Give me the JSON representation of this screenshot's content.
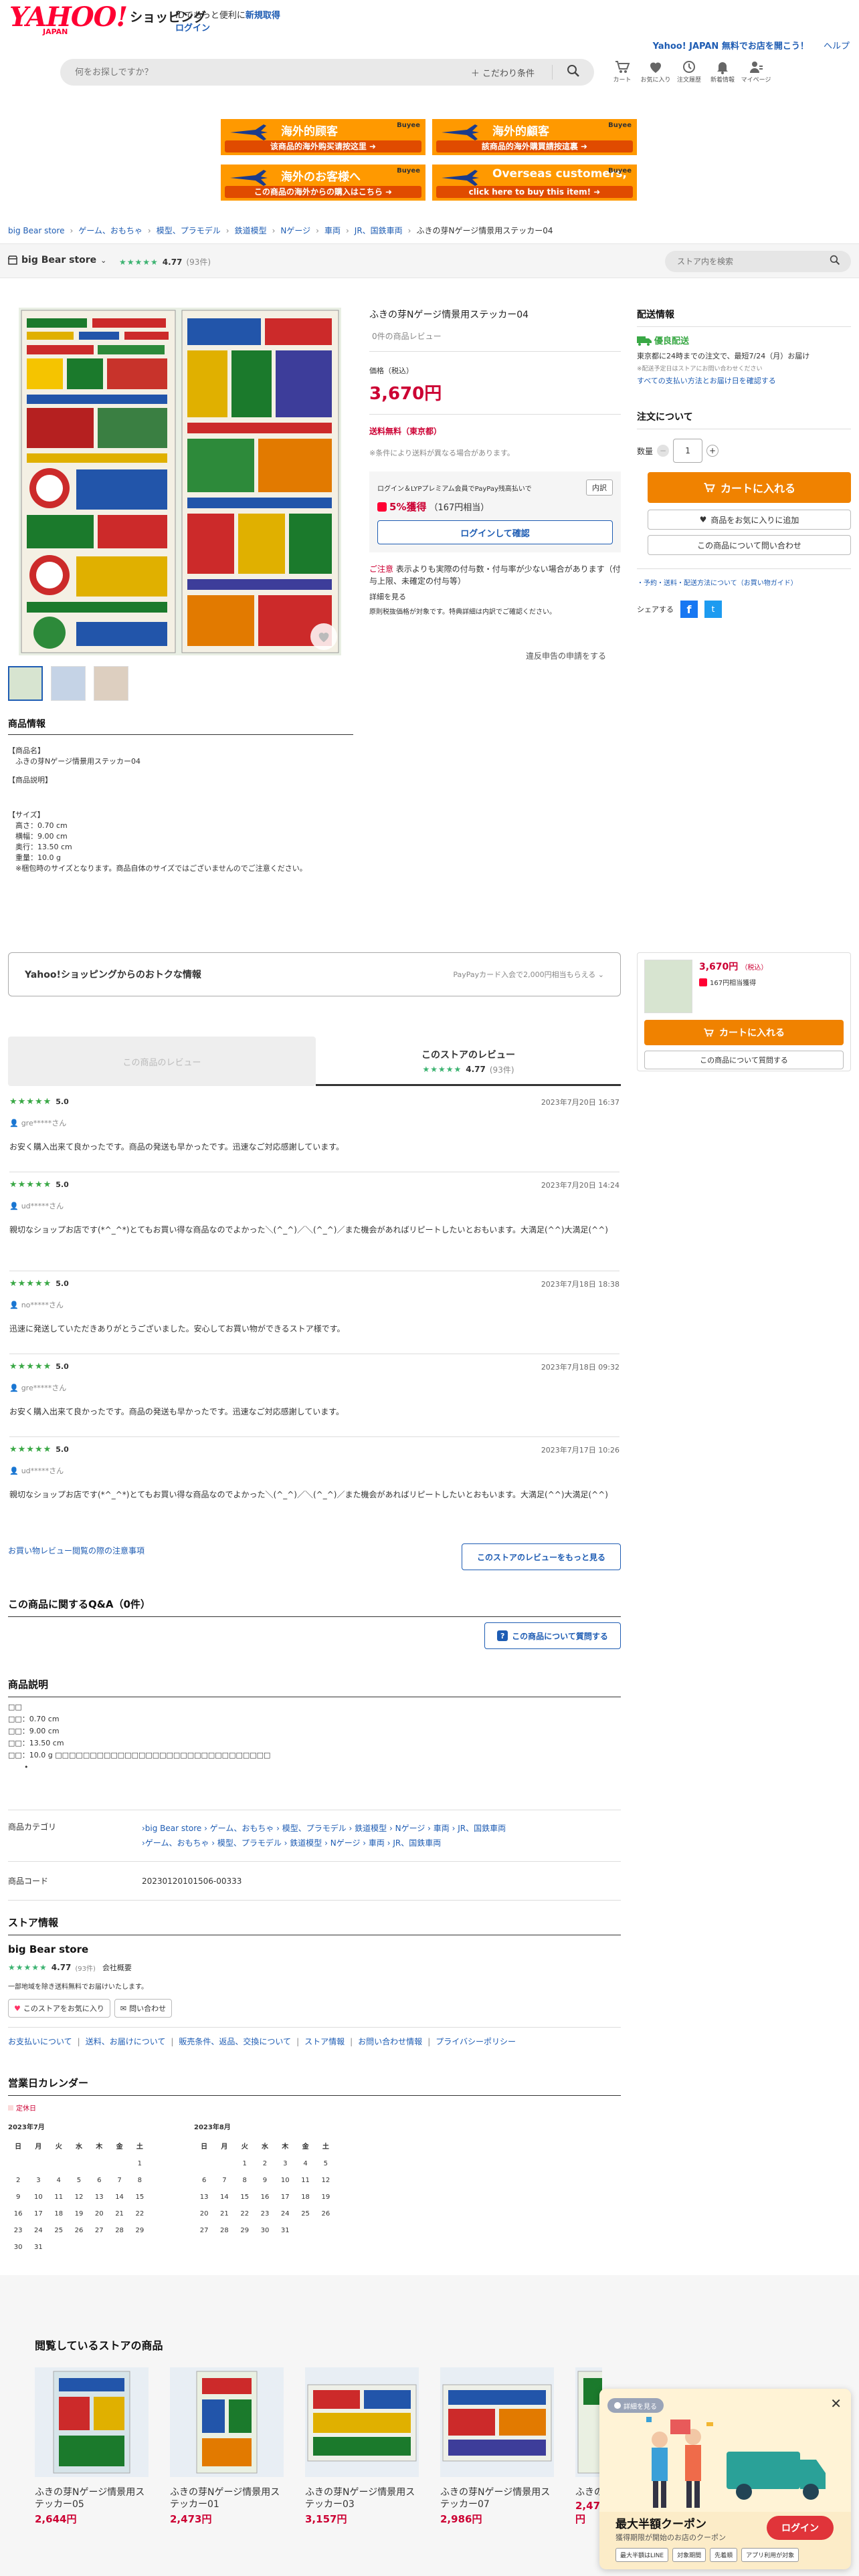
{
  "header": {
    "logo_main": "YAHOO!",
    "logo_sub": "JAPAN",
    "logo_shopping": "ショッピング",
    "id_note_prefix": "IDでもっと便利に",
    "signup": "新規取得",
    "login": "ログイン",
    "top_right_text": "Yahoo! JAPAN  無料でお店を開こう！",
    "help": "ヘルプ",
    "search_placeholder": "何をお探しですか？",
    "filter_label": "＋ こだわり条件",
    "icons": [
      {
        "name": "cart-icon",
        "label": "カート"
      },
      {
        "name": "heart-icon",
        "label": "お気に入り"
      },
      {
        "name": "history-icon",
        "label": "注文履歴"
      },
      {
        "name": "bell-icon",
        "label": "新着情報"
      },
      {
        "name": "user-icon",
        "label": "マイページ"
      }
    ]
  },
  "banners": [
    {
      "t1": "海外的顾客",
      "t2": "该商品的海外购买请按这里 ➜",
      "buyee": "Buyee"
    },
    {
      "t1": "海外的顧客",
      "t2": "該商品的海外購買請按這裏 ➜",
      "buyee": "Buyee"
    },
    {
      "t1": "海外のお客様へ",
      "t2": "この商品の海外からの購入はこちら ➜",
      "buyee": "Buyee"
    },
    {
      "t1": "Overseas customers,",
      "t2": "click here to buy this item! ➜",
      "buyee": "Buyee"
    }
  ],
  "breadcrumb": [
    "big Bear store",
    "ゲーム、おもちゃ",
    "模型、プラモデル",
    "鉄道模型",
    "Nゲージ",
    "車両",
    "JR、国鉄車両",
    "ふきの芽Nゲージ情景用ステッカー04"
  ],
  "store_bar": {
    "store_name": "big Bear store",
    "rating": "4.77",
    "rating_count": "(93件)",
    "search_placeholder": "ストア内を検索"
  },
  "product": {
    "title": "ふきの芽Nゲージ情景用ステッカー04",
    "review_link": "0件の商品レビュー",
    "price_label": "価格（税込）",
    "price": "3,670円",
    "shipping": "送料無料（東京都）",
    "shipping_note": "※条件により送料が異なる場合があります。",
    "pay_note": "ログイン＆LYPプレミアム会員でPayPay残高払いで",
    "pay_badge": "内訳",
    "points": "5%獲得",
    "points_sub": "（167円相当）",
    "login_confirm": "ログインして確認",
    "caution_label": "ご注意",
    "caution_text": "表示よりも実際の付与数・付与率が少ない場合があります（付与上限、未確定の付与等）",
    "detail_link": "詳細を見る",
    "caution_sub": "原則税抜価格が対象です。特典詳細は内訳でご確認ください。",
    "report_link": "違反申告の申請をする"
  },
  "delivery": {
    "title": "配送情報",
    "badge": "優良配送",
    "line1": "東京都に24時までの注文で、最短7/24（月）お届け",
    "line2": "※配送予定日はストアにお問い合わせください",
    "link": "すべての支払い方法とお届け日を確認する",
    "order_title": "注文について",
    "qty_label": "数量",
    "qty": "1",
    "cart_btn": "カートに入れる",
    "fav_btn": "商品をお気に入りに追加",
    "inquiry_btn": "この商品について問い合わせ",
    "links": "・予約・送料・配送方法について（お買い物ガイド）",
    "share": "シェアする"
  },
  "info": {
    "title": "商品情報",
    "lines": [
      "【商品名】",
      "　ふきの芽Nゲージ情景用ステッカー04",
      "",
      "【商品説明】",
      "",
      "",
      "【サイズ】",
      "　高さ：0.70 cm",
      "　横幅：9.00 cm",
      "　奥行：13.50 cm",
      "　重量：10.0 g",
      "　※梱包時のサイズとなります。商品自体のサイズではございませんのでご注意ください。"
    ]
  },
  "deals": {
    "title": "Yahoo!ショッピングからのおトクな情報",
    "right": "PayPayカード入会で2,000円相当もらえる ⌄"
  },
  "mini_cart": {
    "price": "3,670円",
    "tax": "（税込）",
    "points": "167円相当獲得",
    "cart_btn": "カートに入れる",
    "inquiry_btn": "この商品について質問する"
  },
  "reviews": {
    "tab_product": "この商品のレビュー",
    "tab_store": "このストアのレビュー",
    "store_rating": "4.77",
    "store_count": "(93件)",
    "items": [
      {
        "score": "5.0",
        "date": "2023年7月20日 16:37",
        "user": "gre*****さん",
        "text": "お安く購入出来て良かったです。商品の発送も早かったです。迅速なご対応感謝しています。"
      },
      {
        "score": "5.0",
        "date": "2023年7月20日 14:24",
        "user": "ud*****さん",
        "text": "親切なショップお店です(*^_^*)とてもお買い得な商品なのでよかった＼(^_^)／＼(^_^)／また機会があればリピートしたいとおもいます。大満足(^^)大満足(^^)"
      },
      {
        "score": "5.0",
        "date": "2023年7月18日 18:38",
        "user": "no*****さん",
        "text": "迅速に発送していただきありがとうございました。安心してお買い物ができるストア様です。"
      },
      {
        "score": "5.0",
        "date": "2023年7月18日 09:32",
        "user": "gre*****さん",
        "text": "お安く購入出来て良かったです。商品の発送も早かったです。迅速なご対応感謝しています。"
      },
      {
        "score": "5.0",
        "date": "2023年7月17日 10:26",
        "user": "ud*****さん",
        "text": "親切なショップお店です(*^_^*)とてもお買い得な商品なのでよかった＼(^_^)／＼(^_^)／また機会があればリピートしたいとおもいます。大満足(^^)大満足(^^)"
      }
    ],
    "policy_link": "お買い物レビュー閲覧の際の注意事項",
    "more_btn": "このストアのレビューをもっと見る"
  },
  "qa": {
    "title": "この商品に関するQ&A（0件）",
    "btn": "この商品について質問する"
  },
  "description": {
    "title": "商品説明",
    "lines": [
      "□□",
      "□□：0.70 cm",
      "□□：9.00 cm",
      "□□：13.50 cm",
      "□□：10.0 g □□□□□□□□□□□□□□□□□□□□□□□□□□□□□□□"
    ],
    "category_label": "商品カテゴリ",
    "category_1": "›big Bear store › ゲーム、おもちゃ › 模型、プラモデル › 鉄道模型 › Nゲージ › 車両 › JR、国鉄車両",
    "category_2": "›ゲーム、おもちゃ › 模型、プラモデル › 鉄道模型 › Nゲージ › 車両 › JR、国鉄車両",
    "code_label": "商品コード",
    "code": "20230120101506-00333"
  },
  "store_info": {
    "title": "ストア情報",
    "name": "big Bear store",
    "rating": "4.77",
    "rating_count": "(93件)",
    "company": "会社概要",
    "note": "一部地域を除き送料無料でお届けいたします。",
    "fav_btn": "このストアをお気に入り",
    "contact_btn": "問い合わせ",
    "links": [
      "お支払いについて",
      "送料、お届けについて",
      "販売条件、返品、交換について",
      "ストア情報",
      "お問い合わせ情報",
      "プライバシーポリシー"
    ]
  },
  "calendar": {
    "title": "営業日カレンダー",
    "legend": "定休日",
    "weekdays": [
      "日",
      "月",
      "火",
      "水",
      "木",
      "金",
      "土"
    ],
    "months": [
      {
        "label": "2023年7月",
        "days": [
          "",
          "",
          "",
          "",
          "",
          "",
          "1",
          "2",
          "3",
          "4",
          "5",
          "6",
          "7",
          "8",
          "9",
          "10",
          "11",
          "12",
          "13",
          "14",
          "15",
          "16",
          "17",
          "18",
          "19",
          "20",
          "21",
          "22",
          "23",
          "24",
          "25",
          "26",
          "27",
          "28",
          "29",
          "30",
          "31"
        ]
      },
      {
        "label": "2023年8月",
        "days": [
          "",
          "",
          "1",
          "2",
          "3",
          "4",
          "5",
          "6",
          "7",
          "8",
          "9",
          "10",
          "11",
          "12",
          "13",
          "14",
          "15",
          "16",
          "17",
          "18",
          "19",
          "20",
          "21",
          "22",
          "23",
          "24",
          "25",
          "26",
          "27",
          "28",
          "29",
          "30",
          "31"
        ]
      }
    ]
  },
  "browsing": {
    "title": "閲覧しているストアの商品",
    "items": [
      {
        "name": "ふきの芽Nゲージ情景用ステッカー05",
        "price": "2,644円"
      },
      {
        "name": "ふきの芽Nゲージ情景用ステッカー01",
        "price": "2,473円"
      },
      {
        "name": "ふきの芽Nゲージ情景用ステッカー03",
        "price": "3,157円"
      },
      {
        "name": "ふきの芽Nゲージ情景用ステッカー07",
        "price": "2,986円"
      },
      {
        "name": "ふきの芽Nゲージ情景用ステ",
        "price": "2,473円"
      }
    ]
  },
  "coupon": {
    "pill": "詳細を見る",
    "title": "最大半額クーポン",
    "sub": "獲得期限が開始のお店のクーポン",
    "login": "ログイン",
    "tags": [
      "最大半額はLINE",
      "対象期間",
      "先着順",
      "アプリ利用が対象"
    ]
  },
  "colors": {
    "accent_blue": "#1e5cb3",
    "price_red": "#cc0033",
    "orange": "#f08200",
    "star_green": "#3cb371"
  }
}
